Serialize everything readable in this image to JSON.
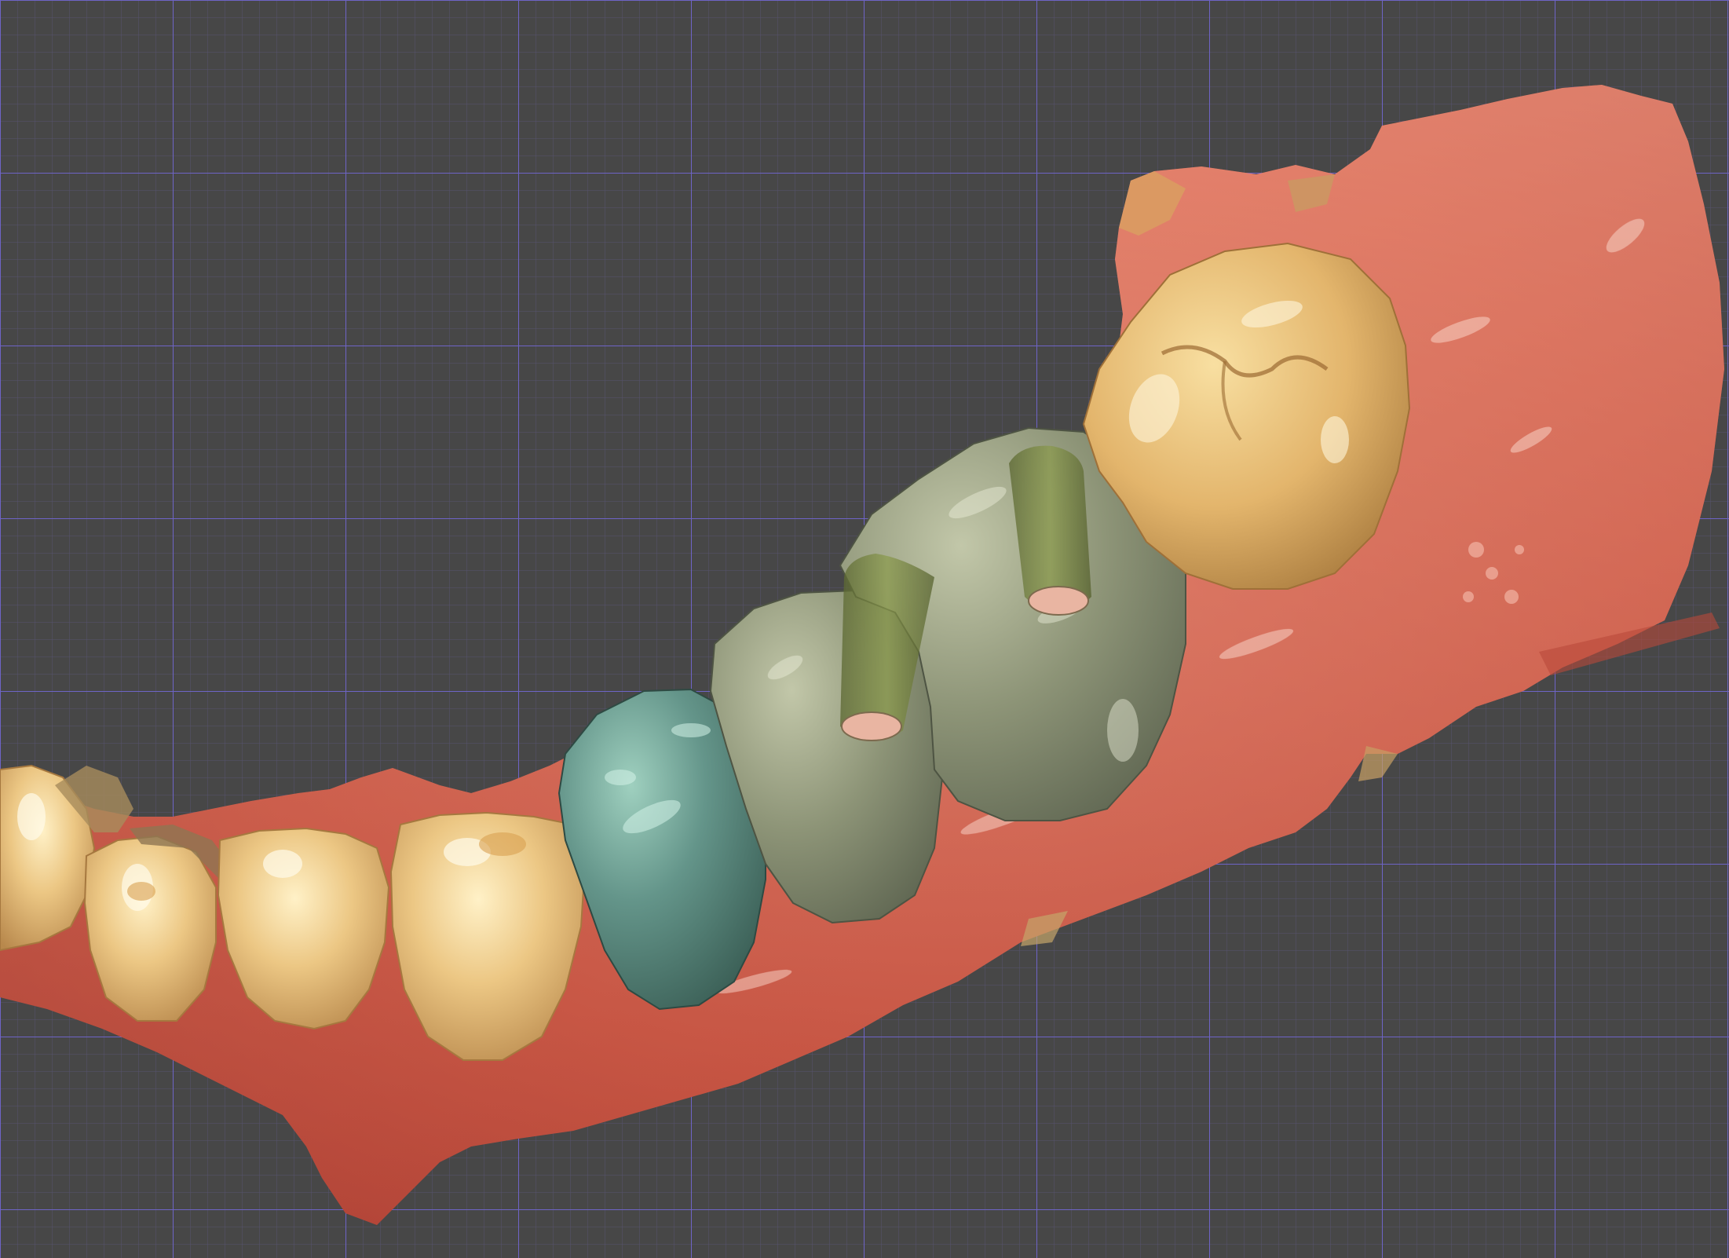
{
  "viewport": {
    "background_color": "#474747",
    "grid_major_color": "#6f66c8",
    "grid_minor_color": "#5b5686",
    "grid_visible": true
  },
  "scene": {
    "gingiva_color": "#d9604c",
    "gingiva_highlight_color": "#f0a08c",
    "natural_tooth_color": "#e6bd78",
    "premolar_crown_color": "#5e8b7b",
    "bridge_color": "#8d9477",
    "screw_channel_color": "#6e7a3a",
    "screw_hole_color": "#e9b5a2"
  }
}
